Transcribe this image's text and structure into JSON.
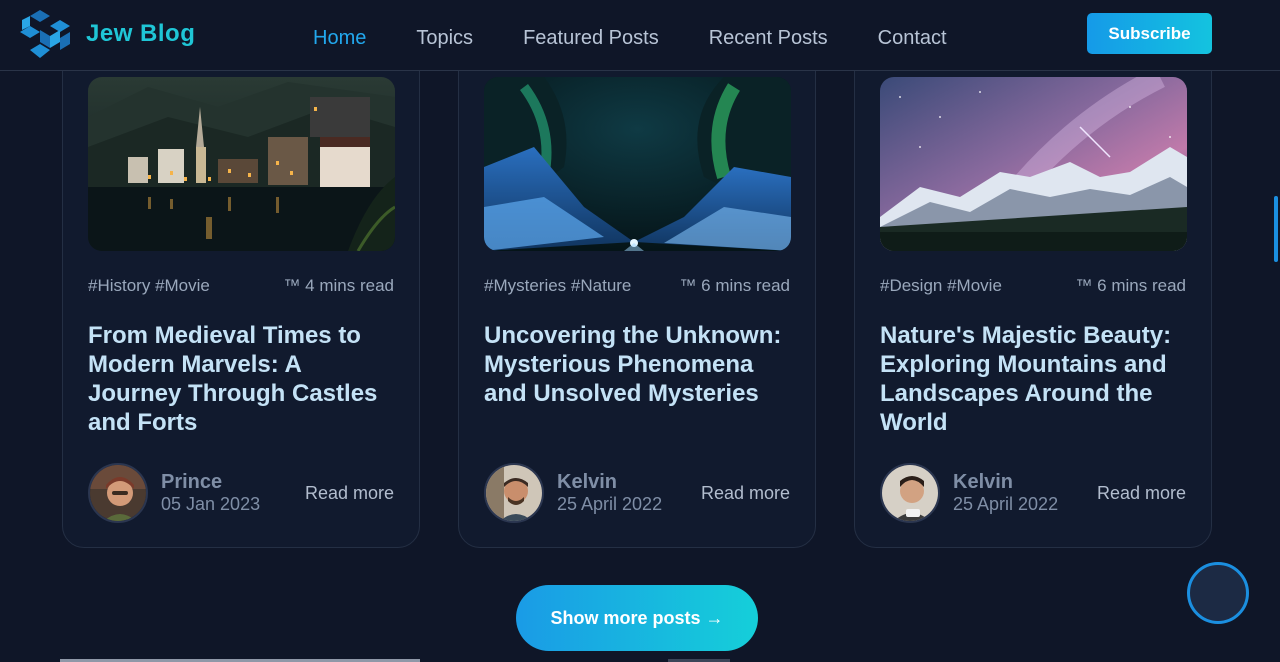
{
  "header": {
    "brand": "Jew Blog",
    "logo_icon": "snowflake-cube-logo",
    "nav": [
      {
        "label": "Home",
        "active": true
      },
      {
        "label": "Topics",
        "active": false
      },
      {
        "label": "Featured Posts",
        "active": false
      },
      {
        "label": "Recent Posts",
        "active": false
      },
      {
        "label": "Contact",
        "active": false
      }
    ],
    "subscribe_label": "Subscribe"
  },
  "posts": [
    {
      "tags": "#History #Movie",
      "read_time": "™ 4 mins read",
      "title": "From Medieval Times to Modern Marvels: A Journey Through Castles and Forts",
      "author": "Prince",
      "date": "05 Jan 2023",
      "read_more": "Read more",
      "image": "lakeside-village-at-night"
    },
    {
      "tags": "#Mysteries #Nature",
      "read_time": "™ 6 mins read",
      "title": "Uncovering the Unknown: Mysterious Phenomena and Unsolved Mysteries",
      "author": "Kelvin",
      "date": "25 April 2022",
      "read_more": "Read more",
      "image": "aurora-over-snowy-canyon"
    },
    {
      "tags": "#Design #Movie",
      "read_time": "™ 6 mins read",
      "title": "Nature's Majestic Beauty: Exploring Mountains and Landscapes Around the World",
      "author": "Kelvin",
      "date": "25 April 2022",
      "read_more": "Read more",
      "image": "milky-way-over-mountains"
    }
  ],
  "show_more_label": "Show more posts →",
  "colors": {
    "background": "#0f1628",
    "accent": "#22a8ee",
    "brand": "#1fc6d6",
    "title": "#c4e2f6"
  }
}
